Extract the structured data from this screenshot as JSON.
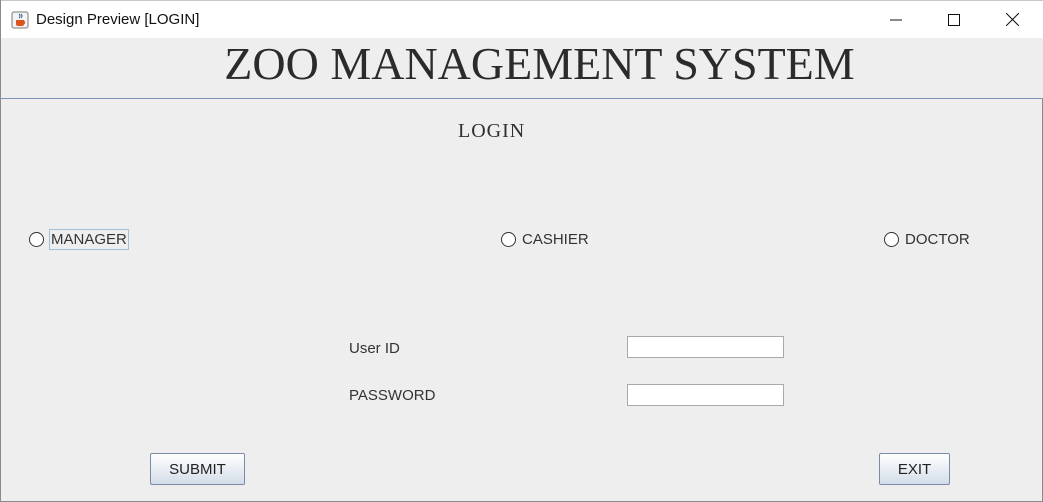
{
  "window": {
    "title": "Design Preview [LOGIN]",
    "icon": "java-cup-icon"
  },
  "header": {
    "title": "ZOO MANAGEMENT SYSTEM"
  },
  "login": {
    "heading": "LOGIN",
    "roles": [
      "MANAGER",
      "CASHIER",
      "DOCTOR"
    ],
    "user_id_label": "User ID",
    "user_id_value": "",
    "password_label": "PASSWORD",
    "password_value": ""
  },
  "buttons": {
    "submit": "SUBMIT",
    "exit": "EXIT"
  }
}
